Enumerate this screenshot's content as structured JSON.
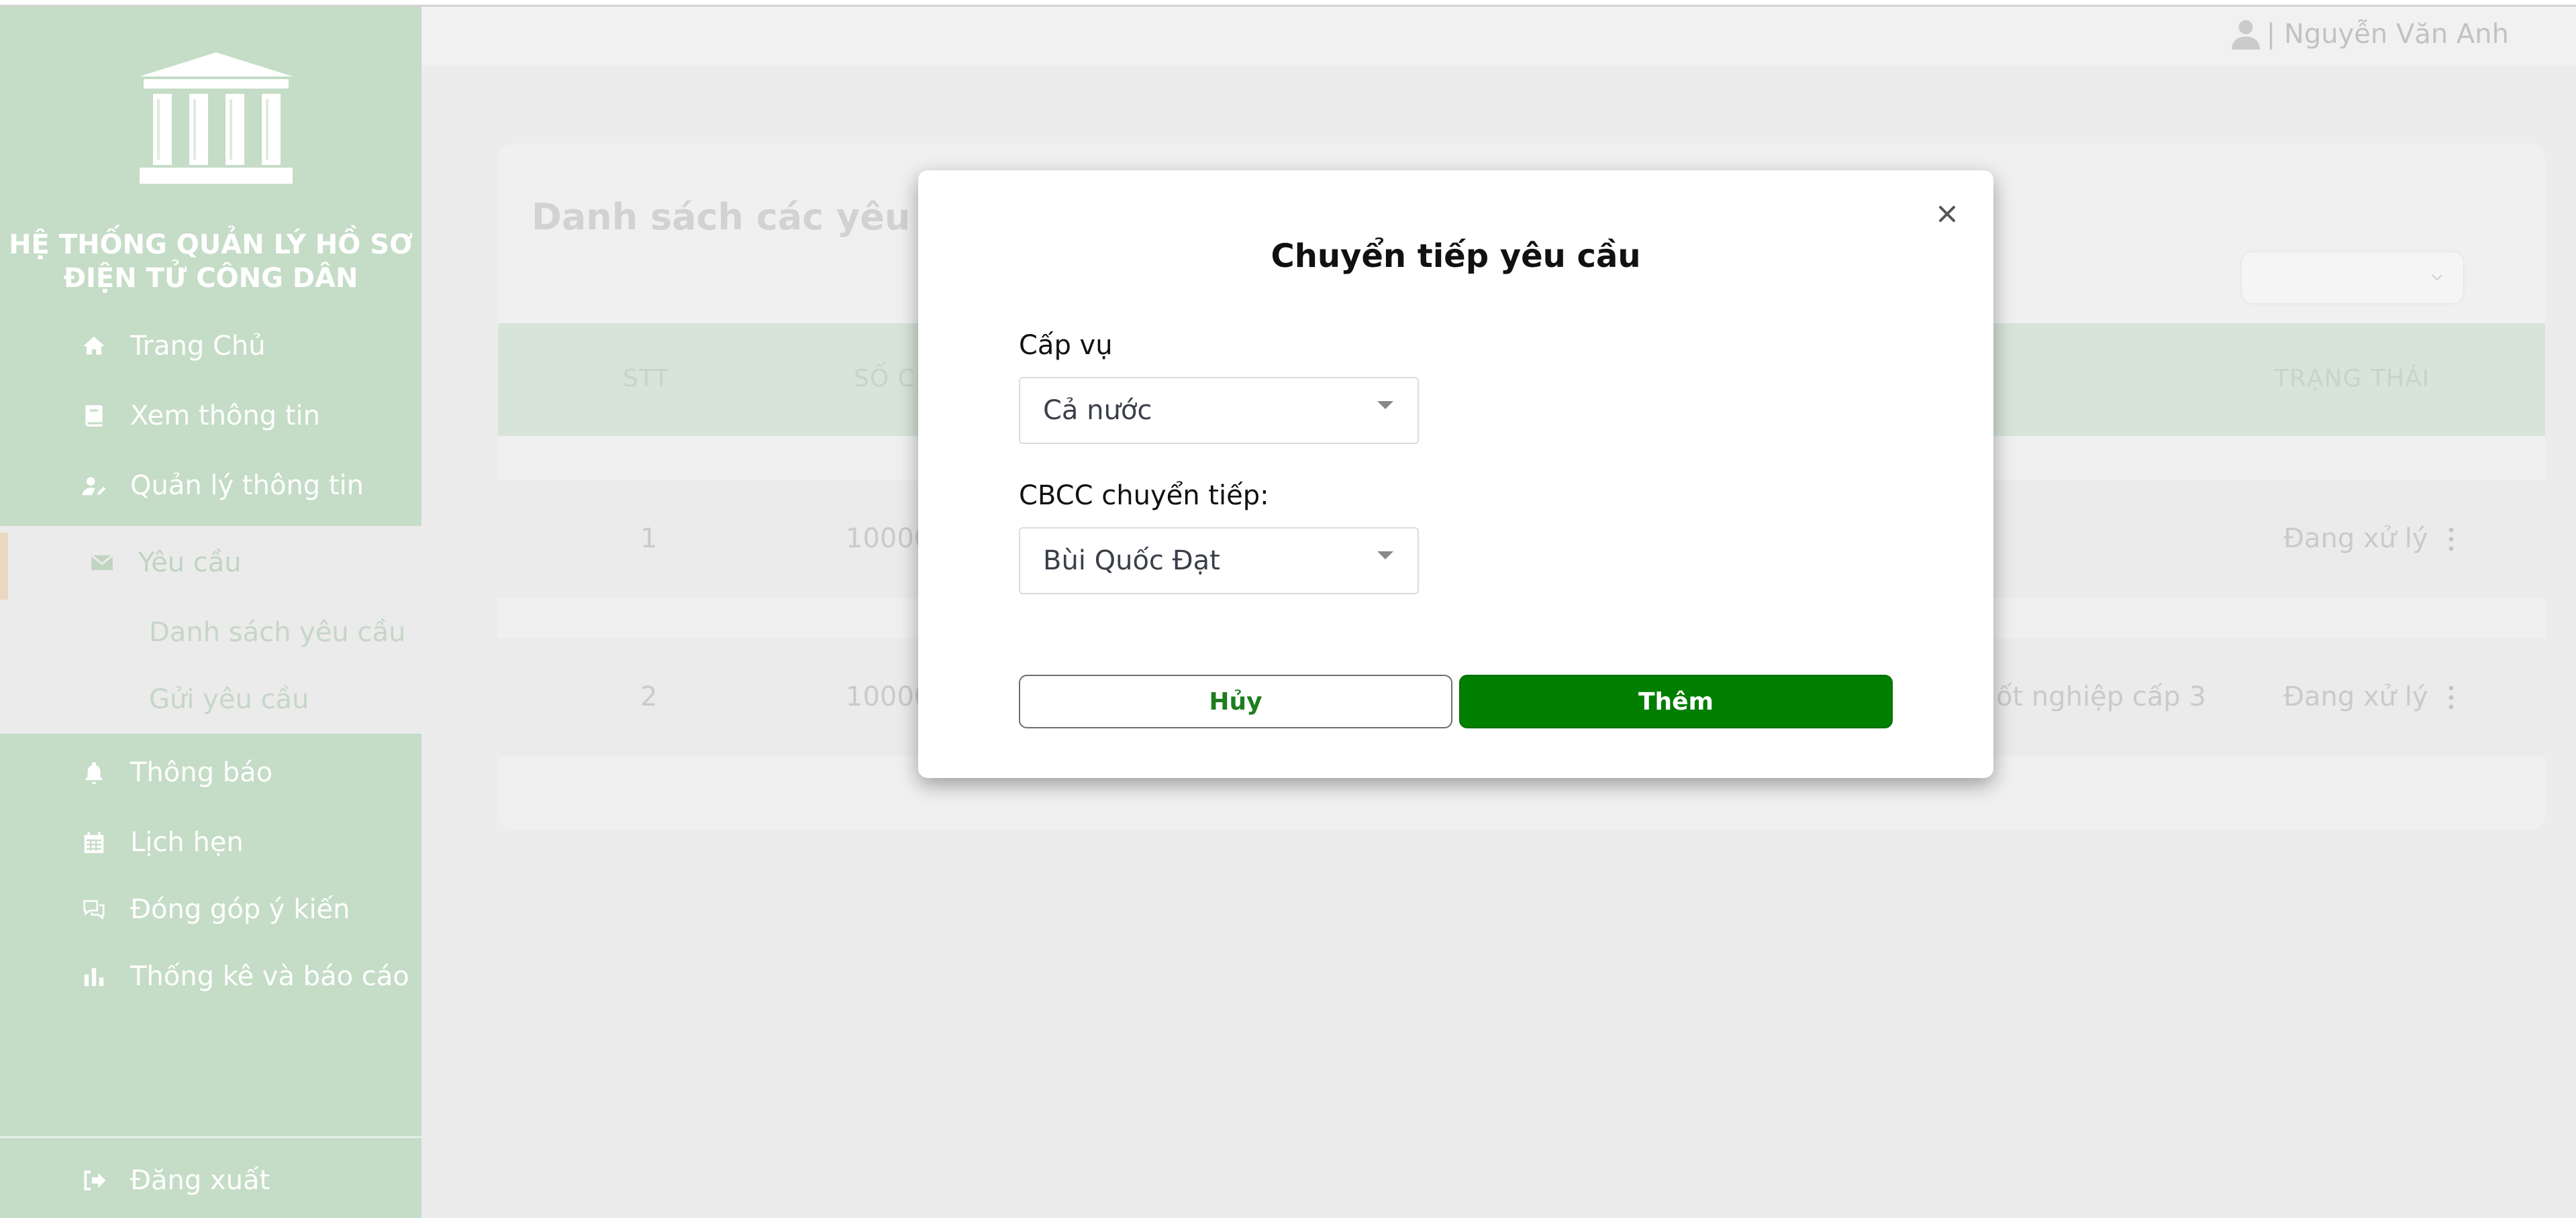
{
  "header": {
    "user_label": "| Nguyễn Văn Anh"
  },
  "sidebar": {
    "system_title_line1": "HỆ THỐNG QUẢN LÝ HỒ SƠ",
    "system_title_line2": "ĐIỆN TỬ CÔNG DÂN",
    "items": [
      {
        "label": "Trang Chủ",
        "icon": "home-icon"
      },
      {
        "label": "Xem thông tin",
        "icon": "book-icon"
      },
      {
        "label": "Quản lý thông tin",
        "icon": "user-edit-icon"
      },
      {
        "label": "Yêu cầu",
        "icon": "envelope-icon",
        "active": true
      },
      {
        "label": "Thông báo",
        "icon": "bell-icon"
      },
      {
        "label": "Lịch hẹn",
        "icon": "calendar-icon"
      },
      {
        "label": "Đóng góp ý kiến",
        "icon": "comments-icon"
      },
      {
        "label": "Thống kê và báo cáo",
        "icon": "bar-chart-icon"
      }
    ],
    "subitems": [
      {
        "label": "Danh sách yêu cầu"
      },
      {
        "label": "Gửi yêu cầu"
      }
    ],
    "logout_label": "Đăng xuất"
  },
  "main": {
    "card_title": "Danh sách các yêu cầ",
    "columns": [
      "STT",
      "SỐ C",
      "TRẠNG THÁI"
    ],
    "rows": [
      {
        "stt": "1",
        "code": "10000",
        "type": "",
        "status": "Đang xử lý"
      },
      {
        "stt": "2",
        "code": "10000",
        "type": "ốt nghiệp cấp 3",
        "status": "Đang xử lý"
      }
    ]
  },
  "modal": {
    "title": "Chuyển tiếp yêu cầu",
    "level_label": "Cấp vụ",
    "level_value": "Cả nước",
    "officer_label": "CBCC chuyển tiếp:",
    "officer_value": "Bùi Quốc Đạt",
    "cancel_label": "Hủy",
    "submit_label": "Thêm"
  },
  "colors": {
    "sidebar_bg": "#c5dcc7",
    "primary_green": "#017f01",
    "overlay_bg": "#ececec"
  }
}
